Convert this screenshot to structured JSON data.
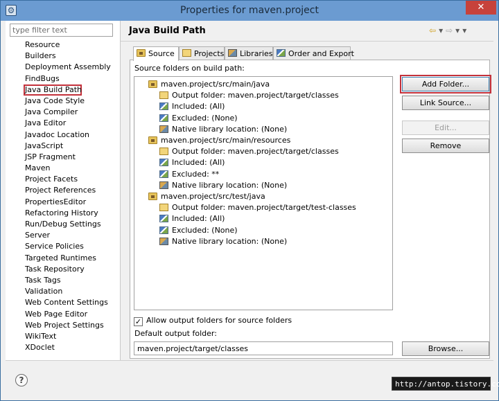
{
  "window": {
    "title": "Properties for maven.project",
    "close_label": "✕",
    "icon": "app-icon"
  },
  "filter": {
    "placeholder": "type filter text"
  },
  "categories": [
    "Resource",
    "Builders",
    "Deployment Assembly",
    "FindBugs",
    "Java Build Path",
    "Java Code Style",
    "Java Compiler",
    "Java Editor",
    "Javadoc Location",
    "JavaScript",
    "JSP Fragment",
    "Maven",
    "Project Facets",
    "Project References",
    "PropertiesEditor",
    "Refactoring History",
    "Run/Debug Settings",
    "Server",
    "Service Policies",
    "Targeted Runtimes",
    "Task Repository",
    "Task Tags",
    "Validation",
    "Web Content Settings",
    "Web Page Editor",
    "Web Project Settings",
    "WikiText",
    "XDoclet"
  ],
  "selected_category": "Java Build Path",
  "page": {
    "title": "Java Build Path",
    "nav": {
      "back": "⇦",
      "back_menu": "▾",
      "forward": "⇨",
      "forward_menu": "▾",
      "menu": "▾"
    }
  },
  "tabs": [
    {
      "label": "Source",
      "active": true,
      "icon": "source-folder-icon"
    },
    {
      "label": "Projects",
      "active": false,
      "icon": "projects-icon"
    },
    {
      "label": "Libraries",
      "active": false,
      "icon": "libraries-icon"
    },
    {
      "label": "Order and Export",
      "active": false,
      "icon": "order-export-icon"
    }
  ],
  "source": {
    "section_label": "Source folders on build path:",
    "folders": [
      {
        "name": "maven.project/src/main/java",
        "output": "Output folder: maven.project/target/classes",
        "included": "Included: (All)",
        "excluded": "Excluded: (None)",
        "native": "Native library location: (None)"
      },
      {
        "name": "maven.project/src/main/resources",
        "output": "Output folder: maven.project/target/classes",
        "included": "Included: (All)",
        "excluded": "Excluded: **",
        "native": "Native library location: (None)"
      },
      {
        "name": "maven.project/src/test/java",
        "output": "Output folder: maven.project/target/test-classes",
        "included": "Included: (All)",
        "excluded": "Excluded: (None)",
        "native": "Native library location: (None)"
      }
    ],
    "buttons": {
      "add_folder": "Add Folder...",
      "link_source": "Link Source...",
      "edit": "Edit...",
      "remove": "Remove",
      "browse": "Browse..."
    },
    "allow_output": {
      "label": "Allow output folders for source folders",
      "checked": true,
      "mark": "✓"
    },
    "default_output_label": "Default output folder:",
    "default_output_value": "maven.project/target/classes"
  },
  "footer": {
    "help": "?",
    "watermark": "http://antop.tistory.com"
  },
  "colors": {
    "selection_outline": "#c3303a",
    "titlebar": "#6b9bd1",
    "close": "#c7423b"
  }
}
